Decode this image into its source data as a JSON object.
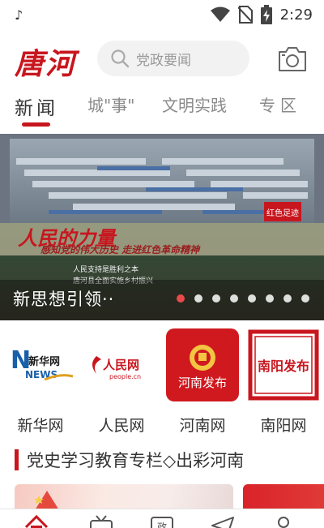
{
  "status_bar": {
    "time": "2:29",
    "left_icon": "tiktok-icon",
    "icons": [
      "wifi-icon",
      "no-sim-icon",
      "battery-charging-icon"
    ]
  },
  "header": {
    "logo_text": "唐河",
    "search_placeholder": "党政要闻",
    "camera_icon": "camera-icon"
  },
  "tabs": [
    {
      "label": "新闻",
      "active": true
    },
    {
      "label": "城\"事\"",
      "active": false
    },
    {
      "label": "文明实践",
      "active": false
    },
    {
      "label": "专区",
      "active": false
    }
  ],
  "banner": {
    "title": "新思想引领··",
    "image_heading": "人民的力量",
    "image_subheading": "感知党的伟大历史 走进红色革命精神",
    "image_lines": [
      "人民支持是胜利之本",
      "唐河县全面实施乡村振兴"
    ],
    "corner_mark": "红色足迹",
    "slide_count": 8,
    "active_slide": 1
  },
  "portals": [
    {
      "label": "新华网",
      "logo_text": "新华网",
      "logo_sub": "NEWS"
    },
    {
      "label": "人民网",
      "logo_text": "人民网",
      "logo_sub": "people.cn"
    },
    {
      "label": "河南网",
      "logo_text": "河南发布"
    },
    {
      "label": "南阳网",
      "logo_text": "南阳发布"
    }
  ],
  "section": {
    "title": "党史学习教育专栏◇出彩河南"
  },
  "colors": {
    "brand_red": "#c8161e",
    "text_dark": "#333333",
    "text_muted": "#8a8a8a"
  },
  "bottom_nav": [
    "home-icon",
    "tv-icon",
    "government-icon",
    "send-icon",
    "profile-icon"
  ]
}
